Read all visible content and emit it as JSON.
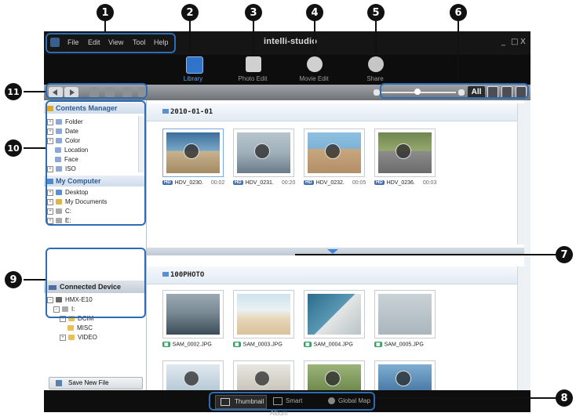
{
  "app": {
    "brand": "intelli-studio",
    "menu": [
      "File",
      "Edit",
      "View",
      "Tool",
      "Help"
    ],
    "window_buttons": [
      "_",
      "□",
      "X"
    ]
  },
  "modes": [
    {
      "label": "Library",
      "icon": "library-icon",
      "color": "#4a90d9"
    },
    {
      "label": "Photo Edit",
      "icon": "photo-edit-icon",
      "color": "#cfcfcf"
    },
    {
      "label": "Movie Edit",
      "icon": "movie-edit-icon",
      "color": "#cfcfcf"
    },
    {
      "label": "Share",
      "icon": "share-globe-icon",
      "color": "#cfcfcf"
    }
  ],
  "view_filter": {
    "all_label": "All"
  },
  "contents_manager": {
    "title": "Contents Manager",
    "items": [
      "Folder",
      "Date",
      "Color",
      "Location",
      "Face",
      "ISO"
    ]
  },
  "my_computer": {
    "title": "My Computer",
    "items": [
      "Desktop",
      "My Documents",
      "C:",
      "E:"
    ]
  },
  "connected_device": {
    "title": "Connected Device",
    "device": "HMX-E10",
    "drive": "I:",
    "folders": [
      "DCIM",
      "MISC",
      "VIDEO"
    ]
  },
  "save_new_file": "Save New File",
  "section1": {
    "title": "2010-01-01",
    "items": [
      {
        "badge": "HD",
        "name": "HDV_0230.",
        "duration": "00:02"
      },
      {
        "badge": "HD",
        "name": "HDV_0231.",
        "duration": "00:20"
      },
      {
        "badge": "HD",
        "name": "HDV_0232.",
        "duration": "00:05"
      },
      {
        "badge": "HD",
        "name": "HDV_0236.",
        "duration": "00:03"
      }
    ]
  },
  "section2": {
    "title": "100PHOTO",
    "items": [
      {
        "name": "SAM_0002.JPG"
      },
      {
        "name": "SAM_0003.JPG"
      },
      {
        "name": "SAM_0004.JPG"
      },
      {
        "name": "SAM_0005.JPG"
      }
    ]
  },
  "bottom_tabs": [
    "Thumbnail",
    "Smart Album",
    "Global Map"
  ],
  "callouts": [
    "1",
    "2",
    "3",
    "4",
    "5",
    "6",
    "7",
    "8",
    "9",
    "10",
    "11"
  ],
  "colors": {
    "accent": "#2c6db5",
    "callout": "#111111",
    "titlebar": "#151515",
    "hd_badge": "#3f6fb6",
    "photo_badge": "#3a9b63"
  }
}
